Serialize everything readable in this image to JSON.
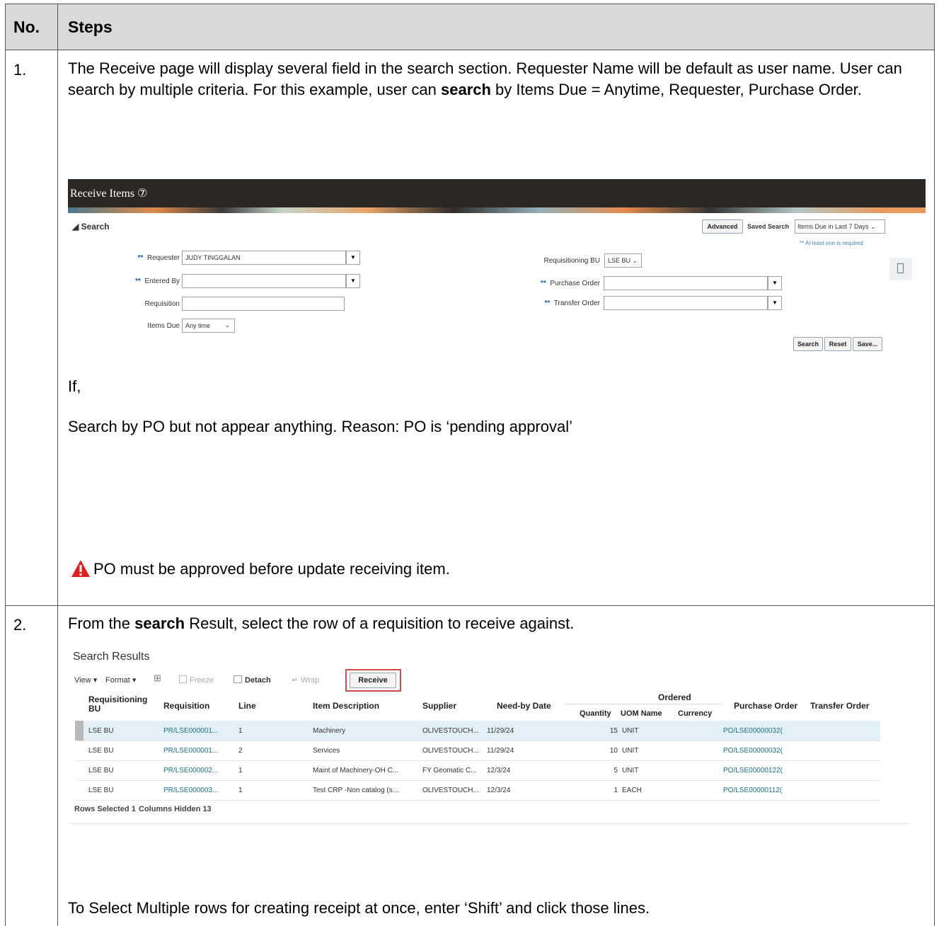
{
  "table": {
    "col_no": "No.",
    "col_steps": "Steps"
  },
  "step1": {
    "num": "1.",
    "text_a": "The Receive page will display several field in the search section. Requester Name will be default as user name. User can search by multiple criteria. For this example, user can ",
    "text_bold": "search",
    "text_b": " by Items Due = Anytime, Requester, Purchase Order.",
    "if_label": "If,",
    "reason": "Search by PO but not appear anything. Reason: PO is ‘pending approval’",
    "warning": "PO must be approved before update receiving item."
  },
  "receive_items": {
    "title": "Receive Items ⑦",
    "search_label": "◢ Search",
    "advanced_btn": "Advanced",
    "saved_search_label": "Saved Search",
    "saved_search_value": "Items Due in Last 7 Days ⌄",
    "required_note": "** At least one is required",
    "stars": "**",
    "requester_label": "Requester",
    "requester_value": "JUDY TINGGALAN",
    "entered_by_label": "Entered By",
    "requisition_label": "Requisition",
    "items_due_label": "Items Due",
    "items_due_value": "Any time",
    "req_bu_label": "Requisitioning BU",
    "req_bu_value": "LSE BU ⌄",
    "po_label": "Purchase Order",
    "to_label": "Transfer Order",
    "search_btn": "Search",
    "reset_btn": "Reset",
    "save_btn": "Save..."
  },
  "step2": {
    "num": "2.",
    "text_a": "From the ",
    "text_bold": "search",
    "text_b": " Result, select the row of a requisition to receive against.",
    "footer": "To Select Multiple rows for creating receipt at once, enter ‘Shift’ and click those lines."
  },
  "results": {
    "title": "Search Results",
    "view": "View ▾",
    "format": "Format ▾",
    "freeze": "Freeze",
    "detach": "Detach",
    "wrap": "Wrap",
    "receive_btn": "Receive",
    "headers": {
      "bu": "Requisitioning BU",
      "requisition": "Requisition",
      "line": "Line",
      "item": "Item Description",
      "supplier": "Supplier",
      "need_by": "Need-by Date",
      "ordered": "Ordered",
      "quantity": "Quantity",
      "uom": "UOM Name",
      "currency": "Currency",
      "po": "Purchase Order",
      "to": "Transfer Order"
    },
    "rows": [
      {
        "bu": "LSE BU",
        "req": "PR/LSE000001...",
        "line": "1",
        "item": "Machinery",
        "supplier": "OLIVESTOUCH...",
        "date": "11/29/24",
        "qty": "15",
        "uom": "UNIT",
        "po": "PO/LSE00000032("
      },
      {
        "bu": "LSE BU",
        "req": "PR/LSE000001...",
        "line": "2",
        "item": "Services",
        "supplier": "OLIVESTOUCH...",
        "date": "11/29/24",
        "qty": "10",
        "uom": "UNIT",
        "po": "PO/LSE00000032("
      },
      {
        "bu": "LSE BU",
        "req": "PR/LSE000002...",
        "line": "1",
        "item": "Maint of Machinery-OH C...",
        "supplier": "FY Geomatic C...",
        "date": "12/3/24",
        "qty": "5",
        "uom": "UNIT",
        "po": "PO/LSE00000122("
      },
      {
        "bu": "LSE BU",
        "req": "PR/LSE000003...",
        "line": "1",
        "item": "Test CRP -Non catalog (s...",
        "supplier": "OLIVESTOUCH...",
        "date": "12/3/24",
        "qty": "1",
        "uom": "EACH",
        "po": "PO/LSE00000112("
      }
    ],
    "rows_selected": "Rows Selected 1",
    "columns_hidden": "Columns Hidden 13"
  }
}
